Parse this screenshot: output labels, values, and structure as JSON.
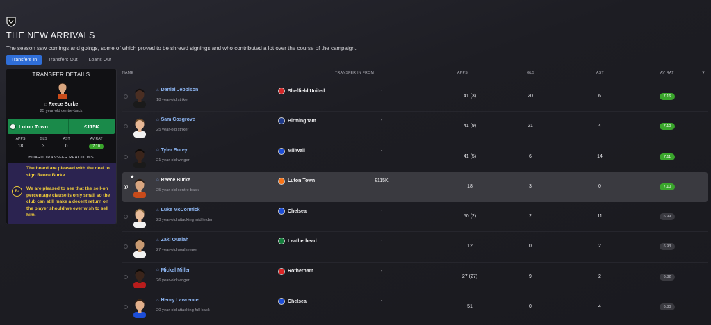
{
  "page": {
    "title": "THE NEW ARRIVALS",
    "subtitle": "The season saw comings and goings, some of which proved to be shrewd signings and who contributed a lot over the course of the campaign."
  },
  "tabs": [
    {
      "label": "Transfers In",
      "active": true
    },
    {
      "label": "Transfers Out",
      "active": false
    },
    {
      "label": "Loans Out",
      "active": false
    }
  ],
  "details": {
    "header": "TRANSFER DETAILS",
    "player_name": "Reece Burke",
    "player_desc": "25 year-old centre-back",
    "club": "Luton Town",
    "fee": "£115K",
    "stats_headers": [
      "APPS",
      "GLS",
      "AST",
      "AV RAT"
    ],
    "stats_values": [
      "18",
      "3",
      "0",
      "7.10"
    ],
    "reactions_title": "BOARD TRANSFER REACTIONS",
    "grade": "B-",
    "reaction_1": "The board are pleased with the deal to sign Reece Burke.",
    "reaction_2": "We are pleased to see that the sell-on percentage clause is only small so the club can still make a decent return on the player should we ever wish to sell him."
  },
  "table": {
    "headers": {
      "name": "NAME",
      "from": "TRANSFER IN FROM",
      "apps": "APPS",
      "gls": "GLS",
      "ast": "AST",
      "av_rat": "AV RAT"
    },
    "rows": [
      {
        "name": "Daniel Jebbison",
        "desc": "18 year-old striker",
        "from": "Sheffield United",
        "fee": "-",
        "apps": "41 (3)",
        "gls": "20",
        "ast": "6",
        "rating": "7.16",
        "rating_class": "good",
        "crest": "#d62828",
        "skin": "#4a2e22",
        "hair": "#141010",
        "shirt": "#1a1a1a"
      },
      {
        "name": "Sam Cosgrove",
        "desc": "25 year-old striker",
        "from": "Birmingham",
        "fee": "-",
        "apps": "41 (9)",
        "gls": "21",
        "ast": "4",
        "rating": "7.10",
        "rating_class": "good",
        "crest": "#1e3a8a",
        "skin": "#e8b896",
        "hair": "#6b4a2a",
        "shirt": "#f2f2f2"
      },
      {
        "name": "Tyler Burey",
        "desc": "21 year-old winger",
        "from": "Millwall",
        "fee": "-",
        "apps": "41 (5)",
        "gls": "6",
        "ast": "14",
        "rating": "7.11",
        "rating_class": "good",
        "crest": "#1d4ed8",
        "skin": "#3a241a",
        "hair": "#0d0a08",
        "shirt": "#1a1a1a"
      },
      {
        "name": "Reece Burke",
        "desc": "25 year-old centre-back",
        "from": "Luton Town",
        "fee": "£115K",
        "apps": "18",
        "gls": "3",
        "ast": "0",
        "rating": "7.10",
        "rating_class": "good",
        "crest": "#f97316",
        "skin": "#d9a680",
        "hair": "#2a1c12",
        "shirt": "#c94b1a",
        "selected": true
      },
      {
        "name": "Luke McCormick",
        "desc": "23 year-old attacking midfielder",
        "from": "Chelsea",
        "fee": "-",
        "apps": "50 (2)",
        "gls": "2",
        "ast": "11",
        "rating": "6.99",
        "rating_class": "avg",
        "crest": "#1d4ed8",
        "skin": "#e8bc9a",
        "hair": "#8a6a40",
        "shirt": "#f2f2f2"
      },
      {
        "name": "Zaki Oualah",
        "desc": "27 year-old goalkeeper",
        "from": "Leatherhead",
        "fee": "-",
        "apps": "12",
        "gls": "0",
        "ast": "2",
        "rating": "6.93",
        "rating_class": "avg",
        "crest": "#15803d",
        "skin": "#c89a72",
        "hair": "#1a120c",
        "shirt": "#f2f2f2"
      },
      {
        "name": "Mickel Miller",
        "desc": "26 year-old winger",
        "from": "Rotherham",
        "fee": "-",
        "apps": "27 (27)",
        "gls": "9",
        "ast": "2",
        "rating": "6.82",
        "rating_class": "avg",
        "crest": "#dc2626",
        "skin": "#3a241a",
        "hair": "#0d0a08",
        "shirt": "#b91c1c"
      },
      {
        "name": "Henry Lawrence",
        "desc": "20 year-old attacking full back",
        "from": "Chelsea",
        "fee": "-",
        "apps": "51",
        "gls": "0",
        "ast": "4",
        "rating": "6.80",
        "rating_class": "avg",
        "crest": "#1d4ed8",
        "skin": "#e2b08c",
        "hair": "#3a2414",
        "shirt": "#1d4ed8"
      }
    ]
  }
}
